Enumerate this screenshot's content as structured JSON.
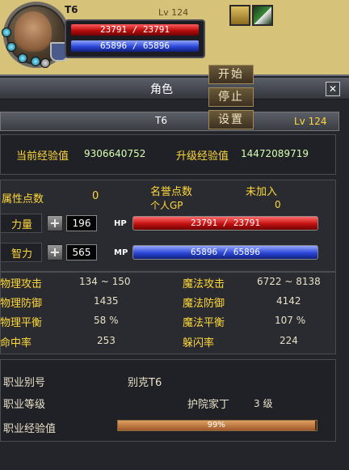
{
  "hud": {
    "name": "T6",
    "level": "Lv 124",
    "hp": "23791 / 23791",
    "mp": "65896 / 65896"
  },
  "menu": {
    "start": "开始",
    "stop": "停止",
    "settings": "设置"
  },
  "window": {
    "title": "角色",
    "close": "✕",
    "char_name": "T6",
    "char_level": "Lv 124"
  },
  "exp": {
    "current_label": "当前经验值",
    "current_value": "9306640752",
    "next_label": "升级经验值",
    "next_value": "14472089719"
  },
  "attr": {
    "points_label": "属性点数",
    "points_value": "0",
    "honor_label": "名誉点数",
    "honor_value": "未加入",
    "gp_label": "个人GP",
    "gp_value": "0",
    "str_label": "力量",
    "str_value": "196",
    "int_label": "智力",
    "int_value": "565",
    "plus": "+",
    "hp_tag": "HP",
    "mp_tag": "MP",
    "hp_bar": "23791 / 23791",
    "mp_bar": "65896 / 65896"
  },
  "combat": {
    "phys_atk_label": "物理攻击",
    "phys_atk_value": "134 ~ 150",
    "mag_atk_label": "魔法攻击",
    "mag_atk_value": "6722 ~ 8138",
    "phys_def_label": "物理防御",
    "phys_def_value": "1435",
    "mag_def_label": "魔法防御",
    "mag_def_value": "4142",
    "phys_bal_label": "物理平衡",
    "phys_bal_value": "58 %",
    "mag_bal_label": "魔法平衡",
    "mag_bal_value": "107 %",
    "hit_label": "命中率",
    "hit_value": "253",
    "dodge_label": "躲闪率",
    "dodge_value": "224"
  },
  "job": {
    "alias_label": "职业别号",
    "alias_value": "别克T6",
    "level_label": "职业等级",
    "rank_value": "护院家丁",
    "level_value": "3 级",
    "exp_label": "职业经验值",
    "exp_text": "99%",
    "exp_fraction": 0.99
  },
  "colors": {
    "hp": "#d01818",
    "mp": "#2b46d6",
    "label_yellow": "#ffd83a",
    "label_green": "#d7ffb0"
  }
}
